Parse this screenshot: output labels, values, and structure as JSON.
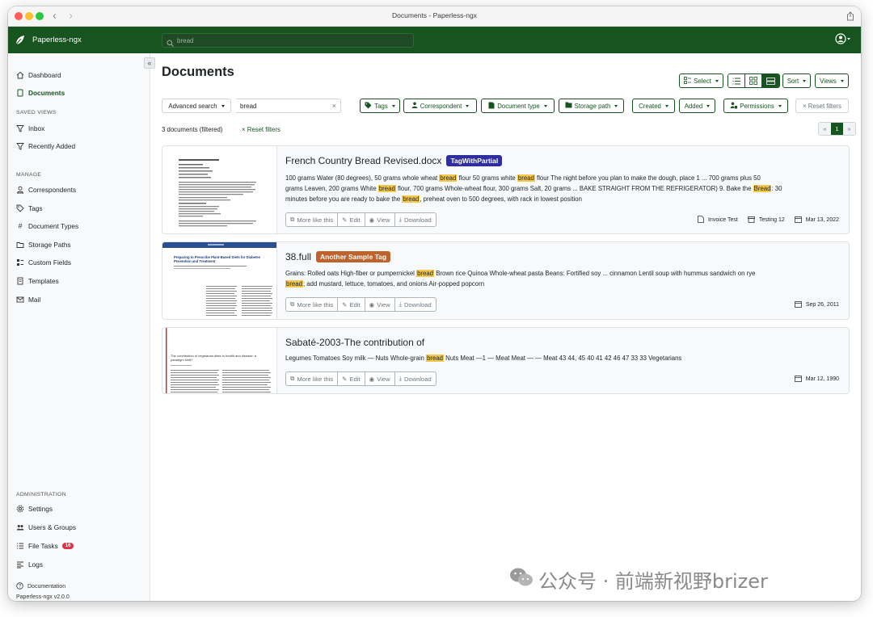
{
  "window": {
    "title": "Documents - Paperless-ngx"
  },
  "topbar": {
    "app_name": "Paperless-ngx",
    "search_value": "bread"
  },
  "sidebar": {
    "items_top": [
      {
        "label": "Dashboard",
        "icon": "house-icon"
      },
      {
        "label": "Documents",
        "icon": "document-icon",
        "active": true
      }
    ],
    "saved_views_heading": "SAVED VIEWS",
    "saved_views": [
      {
        "label": "Inbox",
        "icon": "funnel-icon"
      },
      {
        "label": "Recently Added",
        "icon": "funnel-icon"
      }
    ],
    "manage_heading": "MANAGE",
    "manage": [
      {
        "label": "Correspondents",
        "icon": "person-icon"
      },
      {
        "label": "Tags",
        "icon": "tag-icon"
      },
      {
        "label": "Document Types",
        "icon": "hash-icon"
      },
      {
        "label": "Storage Paths",
        "icon": "folder-icon"
      },
      {
        "label": "Custom Fields",
        "icon": "ui-checks-icon"
      },
      {
        "label": "Templates",
        "icon": "template-icon"
      },
      {
        "label": "Mail",
        "icon": "envelope-icon"
      }
    ],
    "admin_heading": "ADMINISTRATION",
    "admin": [
      {
        "label": "Settings",
        "icon": "gear-icon"
      },
      {
        "label": "Users & Groups",
        "icon": "people-icon"
      },
      {
        "label": "File Tasks",
        "icon": "list-task-icon",
        "badge": "16"
      },
      {
        "label": "Logs",
        "icon": "text-left-icon"
      }
    ],
    "documentation": "Documentation",
    "version": "Paperless-ngx v2.0.0"
  },
  "main": {
    "title": "Documents",
    "toolbar": {
      "select": "Select",
      "sort": "Sort",
      "views": "Views"
    },
    "filters": {
      "search_mode": "Advanced search",
      "search_value": "bread",
      "clear": "×",
      "tags": "Tags",
      "correspondent": "Correspondent",
      "document_type": "Document type",
      "storage_path": "Storage path",
      "created": "Created",
      "added": "Added",
      "permissions": "Permissions",
      "reset": "× Reset filters"
    },
    "count_text": "3 documents (filtered)",
    "reset_link": "× Reset filters",
    "pager": {
      "prev": "«",
      "current": "1",
      "next": "»"
    },
    "actions": {
      "more": "More like this",
      "edit": "Edit",
      "view": "View",
      "download": "Download"
    }
  },
  "documents": [
    {
      "title": "French Country Bread Revised.docx",
      "tag": "TagWithPartial",
      "tag_color": "#2e2e9e",
      "snippet": [
        [
          "100 grams Water (80 degrees), 50 grams whole wheat ",
          "bread",
          " flour 50 grams white ",
          "bread",
          " flour The night before you plan to make the dough, place 1 ... 700 grams plus 50"
        ],
        [
          "grams Leaven, 200 grams White ",
          "bread",
          " flour, 700 grams Whole-wheat flour, 300 grams Salt, 20 grams ... BAKE STRAIGHT FROM THE REFRIGERATOR) 9. Bake the ",
          "Bread",
          ": 30"
        ],
        [
          "minutes before you are ready to bake the ",
          "bread",
          ", preheat oven to 500 degrees, with rack in lowest position"
        ]
      ],
      "document_type": "Invoice Test",
      "storage_path": "Testing 12",
      "date": "Mar 13, 2022"
    },
    {
      "title": "38.full",
      "tag": "Another Sample Tag",
      "tag_color": "#c0622b",
      "snippet": [
        [
          "Grains: Rolled oats High-fiber or pumpernickel ",
          "bread",
          " Brown rice Quinoa Whole-wheat pasta Beans: Fortified soy ... cinnamon Lentil soup with hummus sandwich on rye"
        ],
        [
          "",
          "bread",
          "; add mustard, lettuce, tomatoes, and onions Air-popped popcorn"
        ]
      ],
      "date": "Sep 26, 2011",
      "thumb_heading": "Preparing to Prescribe Plant-Based Diets for Diabetes Prevention and Treatment"
    },
    {
      "title": "Sabaté-2003-The contribution of",
      "tag": "",
      "tag_color": "",
      "snippet": [
        [
          "Legumes Tomatoes Soy milk — Nuts Whole-grain ",
          "bread",
          " Nuts Meat —1 — Meat Meat — — Meat 43 44, 45 40 41 42 46 47 33 33 Vegetarians"
        ]
      ],
      "date": "Mar 12, 1990",
      "thumb_heading": "The contribution of vegetarian diets to health and disease: a paradigm shift?"
    }
  ],
  "watermark": "公众号 · 前端新视野brizer",
  "colors": {
    "primary": "#17541f",
    "highlight": "#f2c94c",
    "badge": "#dc3545"
  }
}
